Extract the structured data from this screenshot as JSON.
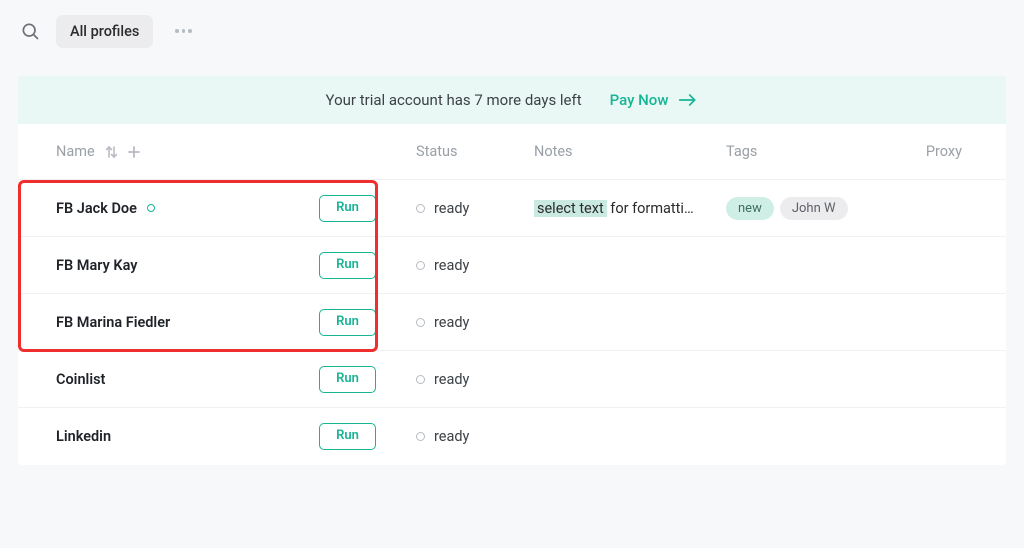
{
  "topbar": {
    "chip_label": "All profiles"
  },
  "banner": {
    "message": "Your trial account has 7 more days left",
    "cta": "Pay Now"
  },
  "columns": {
    "name": "Name",
    "status": "Status",
    "notes": "Notes",
    "tags": "Tags",
    "proxy": "Proxy"
  },
  "run_label": "Run",
  "rows": [
    {
      "name": "FB Jack Doe",
      "has_dot": true,
      "status": "ready",
      "notes_hl": "select text",
      "notes_rest": " for formatti…",
      "tags": [
        {
          "label": "new",
          "cls": "tag-new"
        },
        {
          "label": "John W",
          "cls": "tag-user"
        }
      ]
    },
    {
      "name": "FB Mary Kay",
      "has_dot": false,
      "status": "ready",
      "notes_hl": "",
      "notes_rest": "",
      "tags": []
    },
    {
      "name": "FB Marina Fiedler",
      "has_dot": false,
      "status": "ready",
      "notes_hl": "",
      "notes_rest": "",
      "tags": []
    },
    {
      "name": "Coinlist",
      "has_dot": false,
      "status": "ready",
      "notes_hl": "",
      "notes_rest": "",
      "tags": []
    },
    {
      "name": "Linkedin",
      "has_dot": false,
      "status": "ready",
      "notes_hl": "",
      "notes_rest": "",
      "tags": []
    }
  ]
}
